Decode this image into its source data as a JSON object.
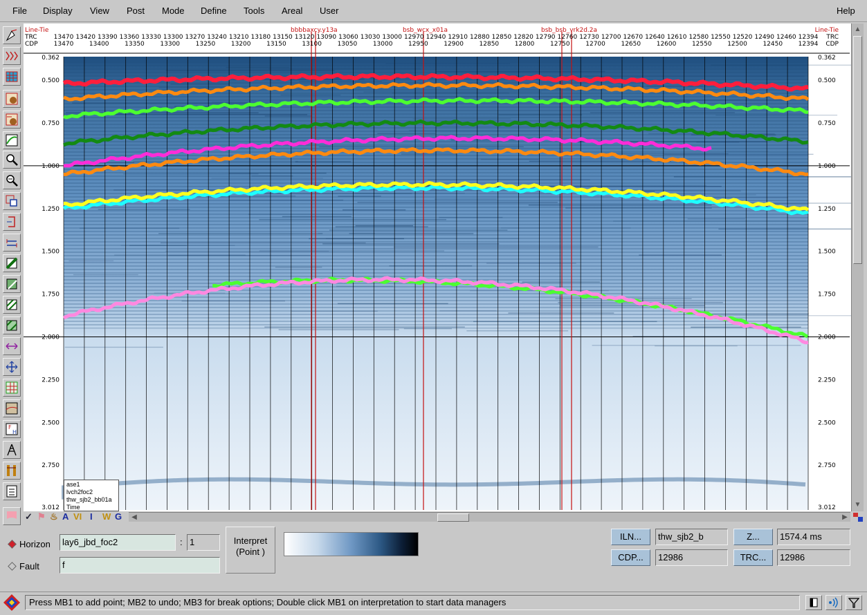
{
  "menu": {
    "items": [
      "File",
      "Display",
      "View",
      "Post",
      "Mode",
      "Define",
      "Tools",
      "Areal",
      "User"
    ],
    "help": "Help"
  },
  "toolbar": {
    "icons": [
      "pointer-tool-icon",
      "line-tie-icon",
      "grid-table-icon",
      "horizon-pick-icon",
      "horizon-flip-icon",
      "horizon-curve-icon",
      "zoom-in-icon",
      "zoom-out-icon",
      "zoom-box-icon",
      "bracket-icon",
      "link-icon",
      "shade-a-icon",
      "shade-b-icon",
      "shade-c-icon",
      "shade-d-icon",
      "arrows-lr-icon",
      "move-icon",
      "grid-icon",
      "map-icon",
      "fault-heave-icon",
      "derrick-icon",
      "tools-icon",
      "numbered-list-icon"
    ]
  },
  "seismic": {
    "header_left": [
      "Line-Tie",
      "TRC",
      "CDP"
    ],
    "header_right": [
      "Line-Tie",
      "TRC",
      "CDP"
    ],
    "trc_labels": [
      "13470",
      "13420",
      "13390",
      "13360",
      "13330",
      "13300",
      "13270",
      "13240",
      "13210",
      "13180",
      "13150",
      "13120",
      "13090",
      "13060",
      "13030",
      "13000",
      "12970",
      "12940",
      "12910",
      "12880",
      "12850",
      "12820",
      "12790",
      "12760",
      "12730",
      "12700",
      "12670",
      "12640",
      "12610",
      "12580",
      "12550",
      "12520",
      "12490",
      "12460",
      "12394"
    ],
    "cdp_labels": [
      "13470",
      "13400",
      "13350",
      "13300",
      "13250",
      "13200",
      "13150",
      "13100",
      "13050",
      "13000",
      "12950",
      "12900",
      "12850",
      "12800",
      "12750",
      "12700",
      "12650",
      "12600",
      "12550",
      "12500",
      "12450",
      "12394"
    ],
    "tie_lines": [
      "bbbbaxcy.y13a",
      "bsb_wcx_x01a",
      "bsb_bsb_vrk2d.2a"
    ],
    "time_labels": [
      "0.362",
      "0.500",
      "0.750",
      "1.000",
      "1.250",
      "1.500",
      "1.750",
      "2.000",
      "2.250",
      "2.500",
      "2.750",
      "3.012"
    ],
    "horizon_colors": [
      "#ff1e3c",
      "#ff8a10",
      "#4cff30",
      "#138a13",
      "#ff2cd8",
      "#ff8a10",
      "#ffff1e",
      "#1effff",
      "#4cff30",
      "#ff88e0"
    ],
    "legend": [
      "ase1",
      "lvch2foc2",
      "thw_sjb2_bb01a",
      "Time"
    ]
  },
  "bottom_tools": [
    "checkmark-icon",
    "flag-icon",
    "paint-icon",
    "A",
    "VI",
    "I",
    "W",
    "G"
  ],
  "horizon": {
    "label": "Horizon",
    "name": "lay6_jbd_foc2",
    "separator": ":",
    "index": "1"
  },
  "fault": {
    "label": "Fault",
    "name": "f"
  },
  "interpret": {
    "line1": "Interpret",
    "line2": "(Point )"
  },
  "readouts": {
    "iln_button": "ILN...",
    "iln_value": "thw_sjb2_b",
    "z_button": "Z...",
    "z_value": "1574.4 ms",
    "cdp_button": "CDP...",
    "cdp_value": "12986",
    "trc_button": "TRC...",
    "trc_value": "12986"
  },
  "status": {
    "message": "Press MB1 to add point; MB2 to undo; MB3 for break options; Double click MB1 on interpretation to start data managers"
  }
}
